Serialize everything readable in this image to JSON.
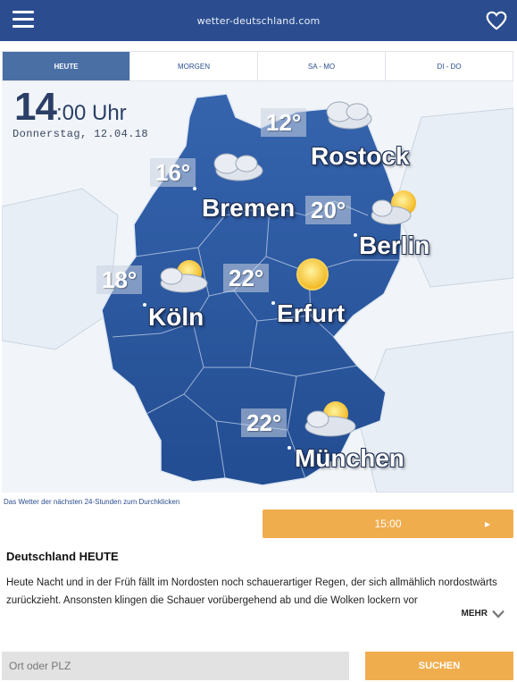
{
  "header": {
    "logo": "wetter-deutschland.com",
    "menu_icon": "hamburger-icon",
    "favorite_icon": "heart-icon"
  },
  "tabs": [
    {
      "label": "HEUTE",
      "active": true
    },
    {
      "label": "MORGEN",
      "active": false
    },
    {
      "label": "SA - MO",
      "active": false
    },
    {
      "label": "DI - DO",
      "active": false
    }
  ],
  "map": {
    "time_hour": "14",
    "time_rest": ":00 Uhr",
    "date": "Donnerstag, 12.04.18",
    "cities": [
      {
        "name": "Rostock",
        "temp": "12°",
        "weather": "cloudy-icon"
      },
      {
        "name": "Bremen",
        "temp": "16°",
        "weather": "cloudy-icon"
      },
      {
        "name": "Berlin",
        "temp": "20°",
        "weather": "partly-cloudy-icon"
      },
      {
        "name": "Köln",
        "temp": "18°",
        "weather": "partly-cloudy-icon"
      },
      {
        "name": "Erfurt",
        "temp": "22°",
        "weather": "sun-icon"
      },
      {
        "name": "München",
        "temp": "22°",
        "weather": "partly-cloudy-icon"
      }
    ],
    "colors": {
      "land": "#2c5aa0",
      "sea": "#eef3f8"
    }
  },
  "hint": "Das Wetter der nächsten 24-Stunden zum Durchklicken",
  "time_bar": {
    "label": "15:00",
    "arrow": "chevron-right-icon"
  },
  "section": {
    "title": "Deutschland HEUTE",
    "body": "Heute Nacht und in der Früh fällt im Nordosten noch schauerartiger Regen, der sich allmählich nordostwärts zurückzieht. Ansonsten klingen die Schauer vorübergehend ab und die Wolken lockern vor",
    "more_label": "MEHR"
  },
  "search": {
    "placeholder": "Ort oder PLZ",
    "button_label": "SUCHEN"
  },
  "accent_colors": {
    "brand": "#2b4d8f",
    "button": "#f0ad4e"
  }
}
